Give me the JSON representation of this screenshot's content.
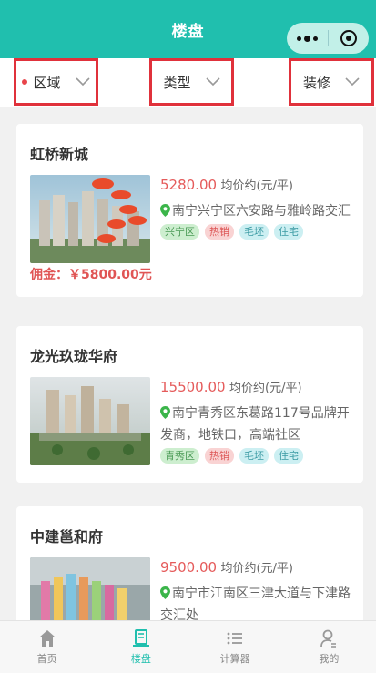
{
  "header": {
    "title": "楼盘"
  },
  "filters": [
    {
      "label": "区域",
      "active": true
    },
    {
      "label": "类型",
      "active": false
    },
    {
      "label": "装修",
      "active": false
    }
  ],
  "listings": [
    {
      "name": "虹桥新城",
      "price": "5280.00",
      "price_unit": "均价约(元/平)",
      "address": "南宁兴宁区六安路与雅岭路交汇",
      "tags": [
        "兴宁区",
        "热销",
        "毛坯",
        "住宅"
      ],
      "commission": "佣金：￥5800.00元"
    },
    {
      "name": "龙光玖珑华府",
      "price": "15500.00",
      "price_unit": "均价约(元/平)",
      "address": "南宁青秀区东葛路117号品牌开发商，地铁口，高端社区",
      "tags": [
        "青秀区",
        "热销",
        "毛坯",
        "住宅"
      ],
      "commission": ""
    },
    {
      "name": "中建邕和府",
      "price": "9500.00",
      "price_unit": "均价约(元/平)",
      "address": "南宁市江南区三津大道与下津路交汇处",
      "tags": [],
      "commission": ""
    }
  ],
  "tabbar": [
    {
      "label": "首页",
      "icon": "home-icon",
      "active": false
    },
    {
      "label": "楼盘",
      "icon": "building-list-icon",
      "active": true
    },
    {
      "label": "计算器",
      "icon": "list-icon",
      "active": false
    },
    {
      "label": "我的",
      "icon": "user-icon",
      "active": false
    }
  ],
  "colors": {
    "accent": "#20bfae",
    "price": "#e55b5b",
    "highlight_border": "#e0313b"
  }
}
